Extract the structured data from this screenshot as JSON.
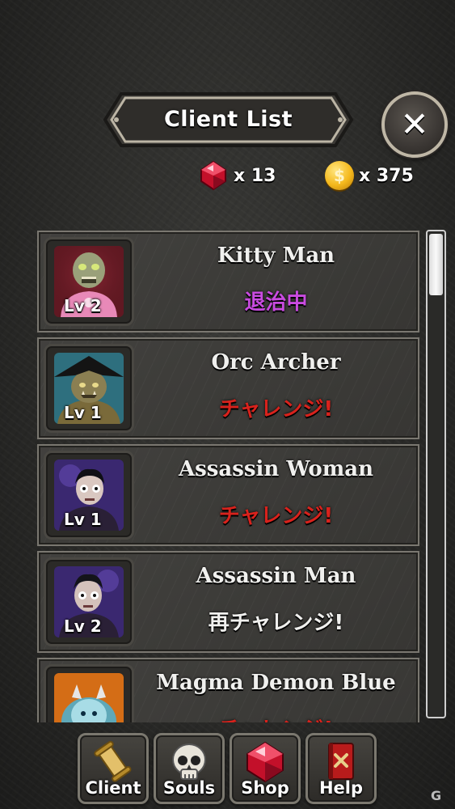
{
  "header": {
    "title": "Client List",
    "close_label": "✕"
  },
  "currency": {
    "gems": "x 13",
    "coins": "x 375",
    "coin_symbol": "$"
  },
  "clients": [
    {
      "name": "Kitty Man",
      "status": "退治中",
      "status_color": "#c94be0",
      "level": "Lv 2",
      "portrait_icon": "zombie-portrait"
    },
    {
      "name": "Orc Archer",
      "status": "チャレンジ!",
      "status_color": "#d8221c",
      "level": "Lv 1",
      "portrait_icon": "orc-portrait"
    },
    {
      "name": "Assassin Woman",
      "status": "チャレンジ!",
      "status_color": "#d8221c",
      "level": "Lv 1",
      "portrait_icon": "assassin-woman-portrait"
    },
    {
      "name": "Assassin Man",
      "status": "再チャレンジ!",
      "status_color": "#f0f0ee",
      "level": "Lv 2",
      "portrait_icon": "assassin-man-portrait"
    },
    {
      "name": "Magma Demon Blue",
      "status": "チャレンジ!",
      "status_color": "#d8221c",
      "level": "",
      "portrait_icon": "magma-demon-portrait"
    }
  ],
  "nav": {
    "client": "Client",
    "souls": "Souls",
    "shop": "Shop",
    "help": "Help"
  },
  "colors": {
    "purple_status": "#c94be0",
    "red_status": "#d8221c",
    "panel": "#3a3936"
  }
}
